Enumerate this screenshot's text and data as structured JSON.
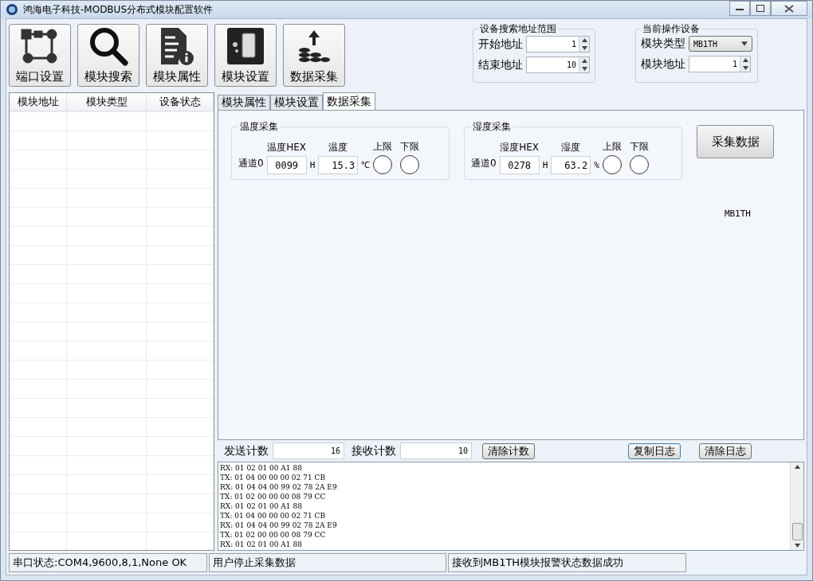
{
  "window": {
    "title": "鸿海电子科技-MODBUS分布式模块配置软件"
  },
  "toolbar": [
    {
      "kind": "port",
      "label": "端口设置"
    },
    {
      "kind": "search",
      "label": "模块搜索"
    },
    {
      "kind": "props",
      "label": "模块属性"
    },
    {
      "kind": "device",
      "label": "模块设置"
    },
    {
      "kind": "collect",
      "label": "数据采集"
    }
  ],
  "search_range": {
    "title": "设备搜索地址范围",
    "fields": [
      {
        "label": "开始地址",
        "value": "1"
      },
      {
        "label": "结束地址",
        "value": "10"
      }
    ]
  },
  "current_device": {
    "title": "当前操作设备",
    "type_label": "模块类型",
    "type_value": "MB1TH",
    "address_label": "模块地址",
    "address_value": "1"
  },
  "device_table": {
    "columns": [
      "模块地址",
      "模块类型",
      "设备状态"
    ]
  },
  "tabs": [
    {
      "label": "模块属性",
      "selected": false
    },
    {
      "label": "模块设置",
      "selected": false
    },
    {
      "label": "数据采集",
      "selected": true
    }
  ],
  "groups": [
    {
      "title": "温度采集",
      "channel": "通道0",
      "hex_label": "温度HEX",
      "hex": "0099",
      "hex_unit": "H",
      "value_label": "温度",
      "value": "15.3",
      "unit": "℃",
      "upper_label": "上限",
      "lower_label": "下限"
    },
    {
      "title": "湿度采集",
      "channel": "通道0",
      "hex_label": "湿度HEX",
      "hex": "0278",
      "hex_unit": "H",
      "value_label": "湿度",
      "value": "63.2",
      "unit": "%",
      "upper_label": "上限",
      "lower_label": "下限"
    }
  ],
  "collect_button": "采集数据",
  "model_label": "MB1TH",
  "counters": {
    "send_label": "发送计数",
    "send": "16",
    "recv_label": "接收计数",
    "recv": "10",
    "clear_count": "清除计数",
    "copy_log": "复制日志",
    "clear_log": "清除日志"
  },
  "log": [
    "RX: 01 02 01 00 A1 88",
    "TX: 01 04 00 00 00 02 71 CB",
    "RX: 01 04 04 00 99 02 78 2A E9",
    "TX: 01 02 00 00 00 08 79 CC",
    "RX: 01 02 01 00 A1 88",
    "TX: 01 04 00 00 00 02 71 CB",
    "RX: 01 04 04 00 99 02 78 2A E9",
    "TX: 01 02 00 00 00 08 79 CC",
    "RX: 01 02 01 00 A1 88"
  ],
  "status_bar": [
    "串口状态:COM4,9600,8,1,None OK",
    "用户停止采集数据",
    "接收到MB1TH模块报警状态数据成功"
  ]
}
